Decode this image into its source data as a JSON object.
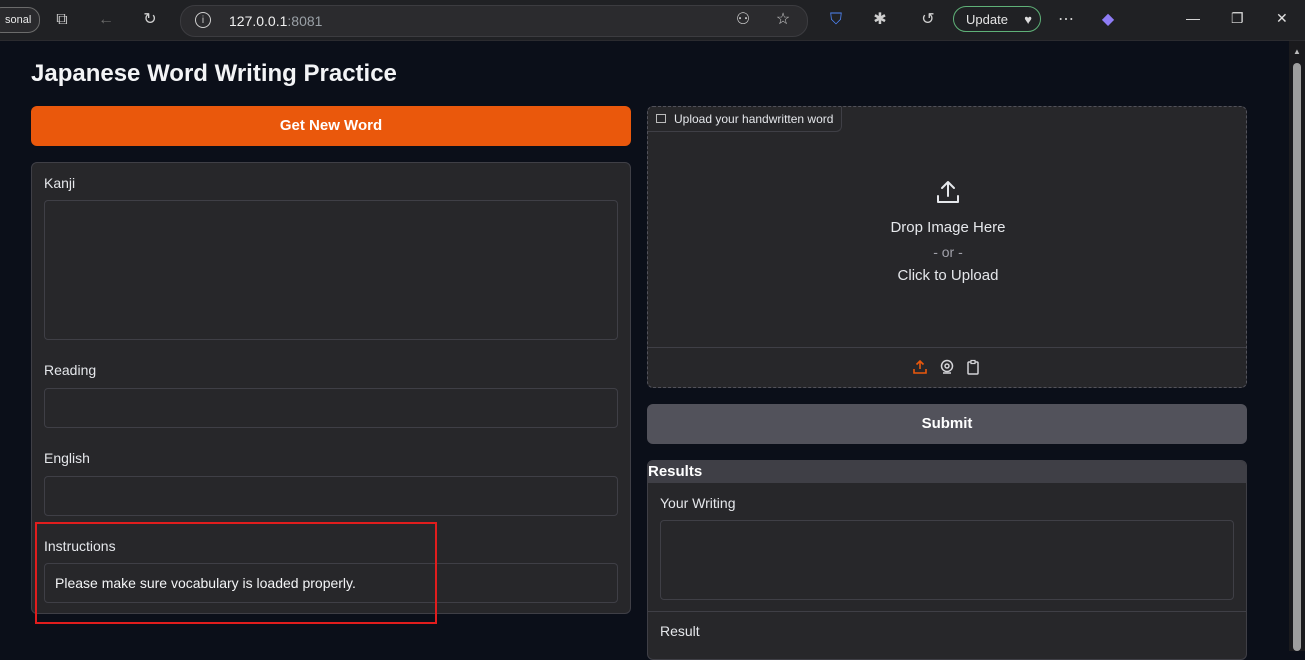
{
  "browser": {
    "profile_label": "sonal",
    "url_host": "127.0.0.1",
    "url_port": ":8081",
    "update_label": "Update"
  },
  "app": {
    "title": "Japanese Word Writing Practice",
    "get_word_button": "Get New Word",
    "fields": {
      "kanji_label": "Kanji",
      "kanji_value": "",
      "reading_label": "Reading",
      "reading_value": "",
      "english_label": "English",
      "english_value": "",
      "instructions_label": "Instructions",
      "instructions_value": "Please make sure vocabulary is loaded properly."
    },
    "upload": {
      "tag_label": "Upload your handwritten word",
      "drop_text": "Drop Image Here",
      "or_text": "- or -",
      "click_text": "Click to Upload",
      "sources": [
        "upload-icon",
        "webcam-icon",
        "clipboard-icon"
      ]
    },
    "submit_button": "Submit",
    "results": {
      "header": "Results",
      "your_writing_label": "Your Writing",
      "your_writing_value": "",
      "result_label": "Result"
    }
  },
  "colors": {
    "accent_orange": "#ea580c",
    "submit_gray": "#52525b",
    "highlight_red": "#e11d1d"
  }
}
